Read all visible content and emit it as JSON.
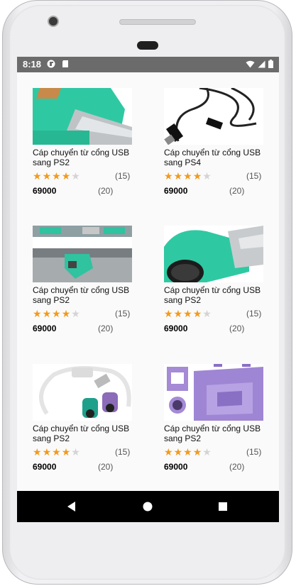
{
  "status_bar": {
    "time": "8:18",
    "left_icons": [
      "fdroid-icon",
      "sdcard-icon"
    ],
    "right_icons": [
      "wifi-icon",
      "signal-icon",
      "battery-icon"
    ]
  },
  "products": [
    {
      "title": "Cáp chuyển từ cổng USB sang PS2",
      "rating": 4,
      "reviews": "(15)",
      "price": "69000",
      "sold": "(20)",
      "image": "green-usb-ps2-adapter"
    },
    {
      "title": "Cáp chuyển từ cổng USB sang PS4",
      "rating": 4,
      "reviews": "(15)",
      "price": "69000",
      "sold": "(20)",
      "image": "black-usb-cable"
    },
    {
      "title": "Cáp chuyển từ cổng USB sang PS2",
      "rating": 4,
      "reviews": "(15)",
      "price": "69000",
      "sold": "(20)",
      "image": "usb-ps2-adapters-on-laptop"
    },
    {
      "title": "Cáp chuyển từ cổng USB sang PS2",
      "rating": 4,
      "reviews": "(15)",
      "price": "69000",
      "sold": "(20)",
      "image": "green-usb-ps2-adapter-closeup"
    },
    {
      "title": "Cáp chuyển từ cổng USB sang PS2",
      "rating": 4,
      "reviews": "(15)",
      "price": "69000",
      "sold": "(20)",
      "image": "usb-to-dual-ps2-splitter"
    },
    {
      "title": "Cáp chuyển từ cổng USB sang PS2",
      "rating": 4,
      "reviews": "(15)",
      "price": "69000",
      "sold": "(20)",
      "image": "purple-ps2-adapter"
    }
  ],
  "nav_bar": {
    "buttons": [
      "back-icon",
      "home-icon",
      "recents-icon"
    ]
  },
  "colors": {
    "star_active": "#f39a1a",
    "star_inactive": "#d4d4d4",
    "status_bar": "#6b6b6b",
    "nav_bar": "#000000"
  }
}
